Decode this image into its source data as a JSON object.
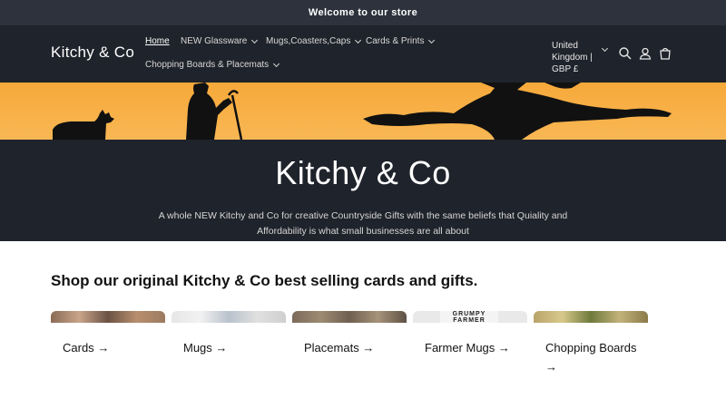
{
  "announcement": "Welcome to our store",
  "header": {
    "logo": "Kitchy & Co",
    "nav": [
      {
        "label": "Home"
      },
      {
        "label": "NEW Glassware"
      },
      {
        "label": "Mugs,Coasters,Caps"
      },
      {
        "label": "Cards & Prints"
      },
      {
        "label": "Chopping Boards & Placemats"
      }
    ],
    "country_line1": "United",
    "country_line2": "Kingdom |",
    "country_line3": "GBP £"
  },
  "hero": {
    "title": "Kitchy & Co",
    "line1": "A whole NEW Kitchy and Co for creative Countryside Gifts with the same beliefs that Quiality and",
    "line2": "Affordability is what small businesses are all about"
  },
  "collection": {
    "title": "Shop our original Kitchy & Co best selling cards and gifts.",
    "cards": [
      {
        "label": "Cards"
      },
      {
        "label": "Mugs"
      },
      {
        "label": "Placemats"
      },
      {
        "label": "Farmer Mugs"
      },
      {
        "label": "Chopping Boards"
      }
    ],
    "mug_text": "GRUMPY FARMER"
  },
  "icons": {
    "search": "search-icon",
    "account": "account-icon",
    "cart": "cart-icon"
  }
}
